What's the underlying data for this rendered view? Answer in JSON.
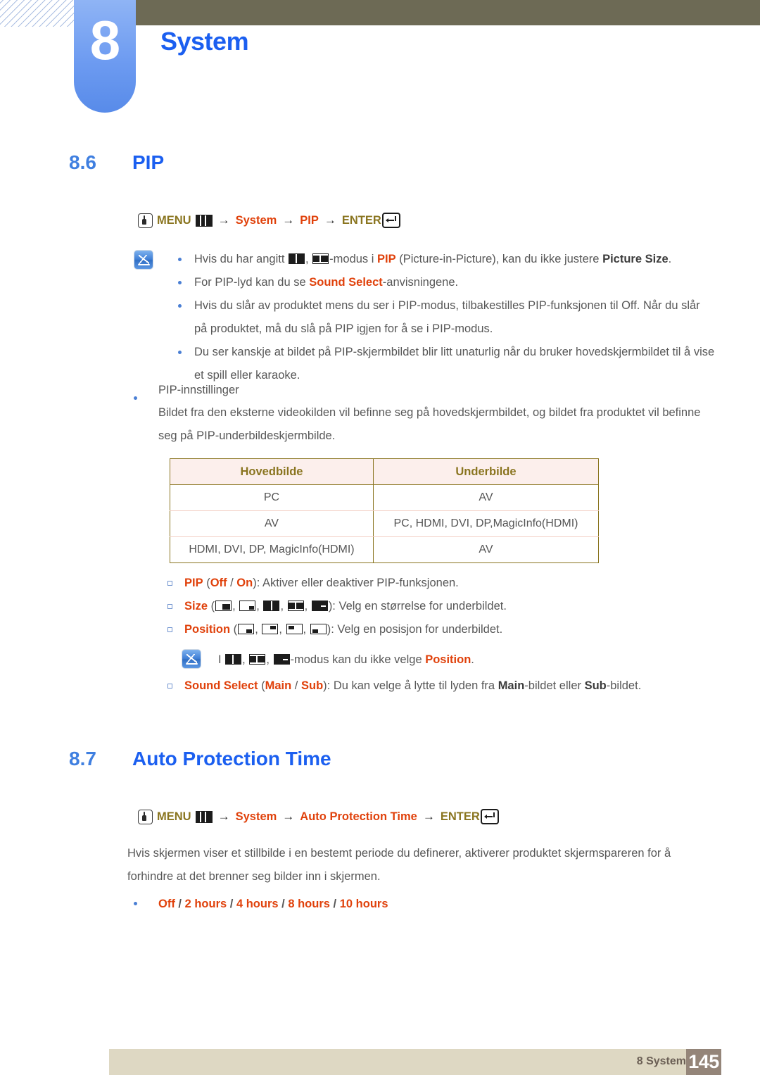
{
  "header": {
    "chapter_number": "8",
    "chapter_title": "System"
  },
  "sections": [
    {
      "number": "8.6",
      "title": "PIP",
      "menu_path": {
        "menu_label": "MENU",
        "arrow": "→",
        "items": [
          "System",
          "PIP"
        ],
        "enter_label": "ENTER"
      }
    },
    {
      "number": "8.7",
      "title": "Auto Protection Time",
      "menu_path": {
        "menu_label": "MENU",
        "arrow": "→",
        "items": [
          "System",
          "Auto Protection Time"
        ],
        "enter_label": "ENTER"
      }
    }
  ],
  "note1": {
    "b1_a": "Hvis du har angitt ",
    "b1_b": ", ",
    "b1_c": "-modus i ",
    "b1_pip": "PIP",
    "b1_d": " (Picture-in-Picture), kan du ikke justere ",
    "b1_ps": "Picture Size",
    "b1_e": ".",
    "b2_a": "For PIP-lyd kan du se ",
    "b2_ss": "Sound Select",
    "b2_b": "-anvisningene.",
    "b3": "Hvis du slår av produktet mens du ser i PIP-modus, tilbakestilles PIP-funksjonen til Off. Når du slår på produktet, må du slå på PIP igjen for å se i PIP-modus.",
    "b4": "Du ser kanskje at bildet på PIP-skjermbildet blir litt unaturlig når du bruker hovedskjermbildet til å vise et spill eller karaoke."
  },
  "pip_settings": {
    "heading": "PIP-innstillinger",
    "intro": "Bildet fra den eksterne videokilden vil befinne seg på hovedskjermbildet, og bildet fra produktet vil befinne seg på PIP-underbildeskjermbilde.",
    "table": {
      "headers": [
        "Hovedbilde",
        "Underbilde"
      ],
      "rows": [
        [
          "PC",
          "AV"
        ],
        [
          "AV",
          "PC, HDMI, DVI, DP,MagicInfo(HDMI)"
        ],
        [
          "HDMI, DVI, DP, MagicInfo(HDMI)",
          "AV"
        ]
      ]
    },
    "items": {
      "pip_label": "PIP",
      "pip_paren_open": " (",
      "pip_off": "Off",
      "pip_slash": " / ",
      "pip_on": "On",
      "pip_desc": "): Aktiver eller deaktiver PIP-funksjonen.",
      "size_label": "Size",
      "size_paren_open": " (",
      "size_sep": ", ",
      "size_desc": "): Velg en størrelse for underbildet.",
      "position_label": "Position",
      "position_paren_open": " (",
      "position_sep": ", ",
      "position_desc": "): Velg en posisjon for underbildet.",
      "sound_label": "Sound Select",
      "sound_paren_open": " (",
      "sound_main": "Main",
      "sound_slash": " / ",
      "sound_sub": "Sub",
      "sound_desc_a": "): Du kan velge å lytte til lyden fra ",
      "sound_main2": "Main",
      "sound_desc_b": "-bildet eller ",
      "sound_sub2": "Sub",
      "sound_desc_c": "-bildet."
    }
  },
  "note2": {
    "lead": "I ",
    "sep": ", ",
    "tail_a": "-modus kan du ikke velge ",
    "position": "Position",
    "tail_b": "."
  },
  "auto_protection": {
    "description": "Hvis skjermen viser et stillbilde i en bestemt periode du definerer, aktiverer produktet skjermspareren for å forhindre at det brenner seg bilder inn i skjermen.",
    "options": {
      "off": "Off",
      "s1": " / ",
      "h2": "2 hours",
      "s2": " / ",
      "h4": "4 hours",
      "s3": " / ",
      "h8": "8 hours",
      "s4": " / ",
      "h10": "10 hours"
    }
  },
  "footer": {
    "label": "8 System",
    "page": "145"
  },
  "colors": {
    "accent_blue": "#1b5ff0",
    "accent_red": "#e0410b",
    "accent_olive": "#8a7520",
    "header_bar": "#6d6a55",
    "footer_bar": "#ded8c3",
    "page_block": "#948579"
  }
}
